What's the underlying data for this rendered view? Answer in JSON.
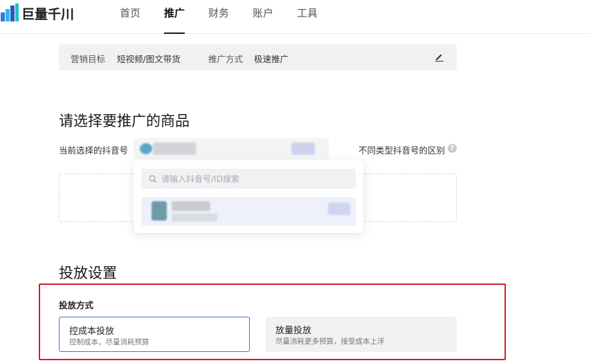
{
  "header": {
    "brand": "巨量千川",
    "nav": [
      "首页",
      "推广",
      "财务",
      "账户",
      "工具"
    ],
    "active_index": 1
  },
  "summary": {
    "goal_label": "营销目标",
    "goal_value": "短视频/图文带货",
    "method_label": "推广方式",
    "method_value": "极速推广",
    "edit_icon": "pencil-icon"
  },
  "product_section": {
    "title": "请选择要推广的商品",
    "account_label": "当前选择的抖音号",
    "diff_link": "不同类型抖音号的区别",
    "help_icon": "question-circle-icon"
  },
  "dropdown": {
    "search_placeholder": "请输入抖音号/ID搜索",
    "search_icon": "search-icon"
  },
  "delivery": {
    "title": "投放设置",
    "mode_label": "投放方式",
    "options": [
      {
        "title": "控成本投放",
        "desc": "控制成本，尽量消耗预算"
      },
      {
        "title": "放量投放",
        "desc": "尽量消耗更多预算，接受成本上浮"
      }
    ],
    "selected_index": 0
  },
  "colors": {
    "accent": "#4a6fdc",
    "highlight_frame": "#d0202a",
    "panel_bg": "#f0f1f3"
  }
}
